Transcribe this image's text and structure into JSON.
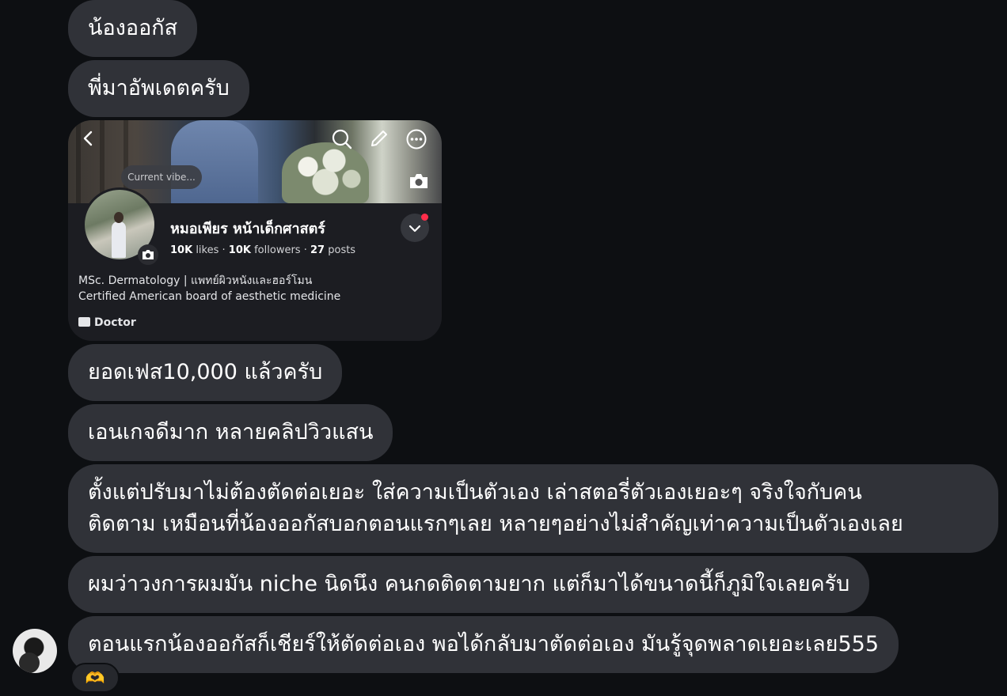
{
  "messages": [
    {
      "text": "น้องออกัส"
    },
    {
      "text": "พี่มาอัพเดตครับ"
    },
    {
      "text": "ยอดเฟส10,000 แล้วครับ"
    },
    {
      "text": "เอนเกจดีมาก หลายคลิปวิวแสน"
    },
    {
      "lines": [
        "ตั้งแต่ปรับมาไม่ต้องตัดต่อเยอะ ใส่ความเป็นตัวเอง เล่าสตอรี่ตัวเองเยอะๆ จริงใจกับคน",
        "ติดตาม เหมือนที่น้องออกัสบอกตอนแรกๆเลย หลายๆอย่างไม่สำคัญเท่าความเป็นตัวเองเลย"
      ]
    },
    {
      "text": "ผมว่าวงการผมมัน niche นิดนึง คนกดติดตามยาก แต่ก็มาได้ขนาดนี้ก็ภูมิใจเลยครับ"
    },
    {
      "text": "ตอนแรกน้องออกัสก็เชียร์ให้ตัดต่อเอง พอได้กลับมาตัดต่อเอง มันรู้จุดพลาดเยอะเลย555"
    }
  ],
  "shared_screenshot": {
    "note_bubble": "Current vibe...",
    "profile_name": "หมอเพียร หน้าเด็กศาสตร์",
    "stats": {
      "likes_count": "10K",
      "likes_label": "likes",
      "followers_count": "10K",
      "followers_label": "followers",
      "posts_count": "27",
      "posts_label": "posts",
      "separator": "·"
    },
    "bio_lines": [
      "MSc. Dermatology | แพทย์ผิวหนังและฮอร์โมน",
      "Certified American board of aesthetic medicine"
    ],
    "category": "Doctor",
    "icons": [
      "back-icon",
      "search-icon",
      "edit-icon",
      "more-icon",
      "camera-icon",
      "chevron-down-icon"
    ],
    "notification_dot_color": "#ff2d4a"
  },
  "reaction": {
    "emoji": "🫶"
  },
  "colors": {
    "background": "#0d0f12",
    "bubble": "#303238",
    "text": "#ffffff"
  }
}
